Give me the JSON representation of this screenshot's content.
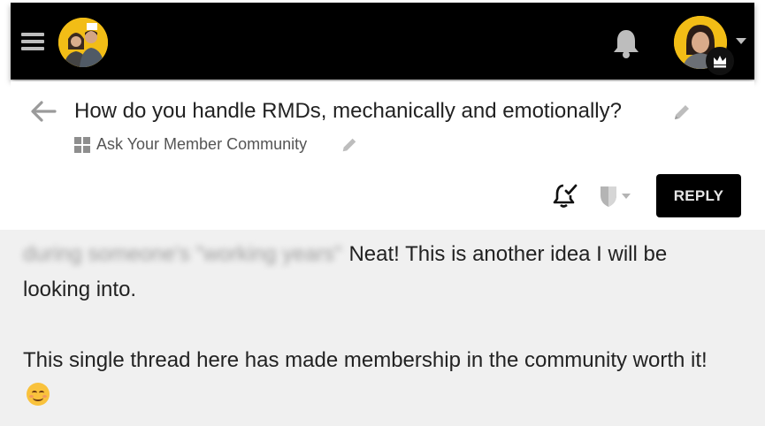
{
  "header": {
    "menu_icon": "hamburger-menu-icon",
    "site_avatar_icon": "site-logo-avatar",
    "notifications_icon": "bell-icon",
    "user_avatar_icon": "user-avatar",
    "user_badge_icon": "crown-icon",
    "user_menu_icon": "chevron-down-icon",
    "accent_color": "#f2bd16",
    "background_color": "#000000"
  },
  "topic": {
    "back_icon": "back-arrow-icon",
    "title": "How do you handle RMDs, mechanically and emotionally?",
    "edit_title_icon": "pencil-icon",
    "category_icon": "grid-icon",
    "category": "Ask Your Member Community",
    "edit_category_icon": "pencil-icon"
  },
  "controls": {
    "notification_level_icon": "bell-check-icon",
    "bookmark_icon": "shield-dropdown-icon",
    "reply_label": "REPLY"
  },
  "post": {
    "quoted_blurred": "during someone's \"working years\"",
    "line1": "Neat! This is another idea I will be looking into.",
    "line2": "This single thread here has made membership in the community worth it!",
    "emoji": "smiling-face-icon"
  }
}
